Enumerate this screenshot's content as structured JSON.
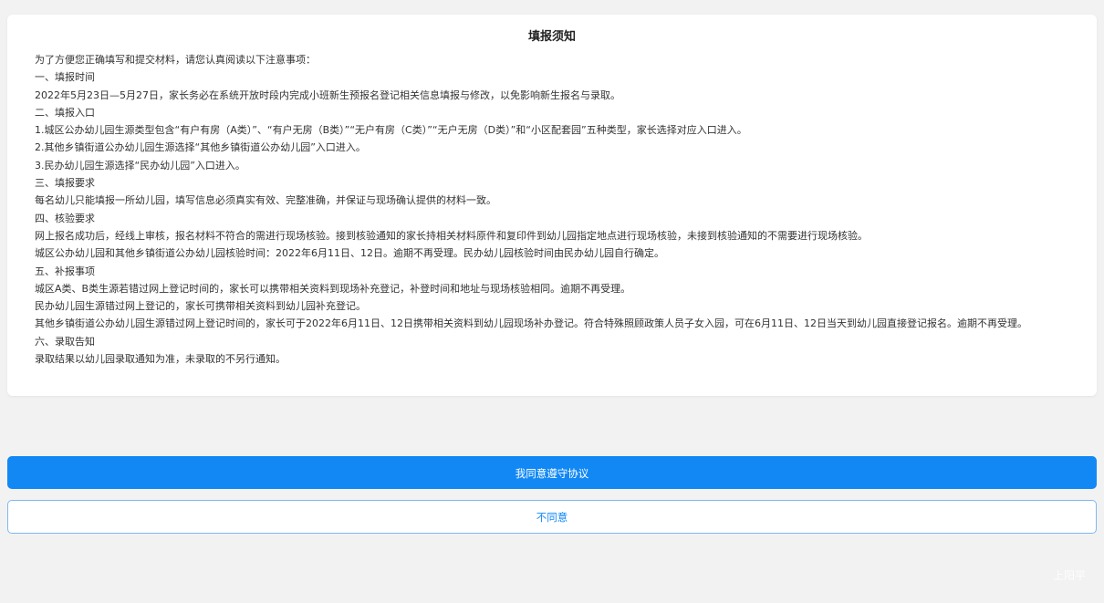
{
  "notice": {
    "title": "填报须知",
    "lines": [
      "为了方便您正确填写和提交材料，请您认真阅读以下注意事项：",
      "一、填报时间",
      "2022年5月23日—5月27日，家长务必在系统开放时段内完成小班新生预报名登记相关信息填报与修改，以免影响新生报名与录取。",
      "二、填报入口",
      "1.城区公办幼儿园生源类型包含“有户有房（A类）”、“有户无房（B类）”“无户有房（C类）”“无户无房（D类）”和“小区配套园”五种类型，家长选择对应入口进入。",
      "2.其他乡镇街道公办幼儿园生源选择“其他乡镇街道公办幼儿园”入口进入。",
      "3.民办幼儿园生源选择“民办幼儿园”入口进入。",
      "三、填报要求",
      "每名幼儿只能填报一所幼儿园，填写信息必须真实有效、完整准确，并保证与现场确认提供的材料一致。",
      "四、核验要求",
      "网上报名成功后，经线上审核，报名材料不符合的需进行现场核验。接到核验通知的家长持相关材料原件和复印件到幼儿园指定地点进行现场核验，未接到核验通知的不需要进行现场核验。",
      "城区公办幼儿园和其他乡镇街道公办幼儿园核验时间：2022年6月11日、12日。逾期不再受理。民办幼儿园核验时间由民办幼儿园自行确定。",
      "五、补报事项",
      "城区A类、B类生源若错过网上登记时间的，家长可以携带相关资料到现场补充登记，补登时间和地址与现场核验相同。逾期不再受理。",
      "民办幼儿园生源错过网上登记的，家长可携带相关资料到幼儿园补充登记。",
      "其他乡镇街道公办幼儿园生源错过网上登记时间的，家长可于2022年6月11日、12日携带相关资料到幼儿园现场补办登记。符合特殊照顾政策人员子女入园，可在6月11日、12日当天到幼儿园直接登记报名。逾期不再受理。",
      "六、录取告知",
      "录取结果以幼儿园录取通知为准，未录取的不另行通知。"
    ]
  },
  "buttons": {
    "agree_label": "我同意遵守协议",
    "disagree_label": "不同意"
  },
  "watermark": "上阳平",
  "colors": {
    "primary": "#1288f5",
    "background": "#f2f2f2",
    "card": "#ffffff"
  }
}
